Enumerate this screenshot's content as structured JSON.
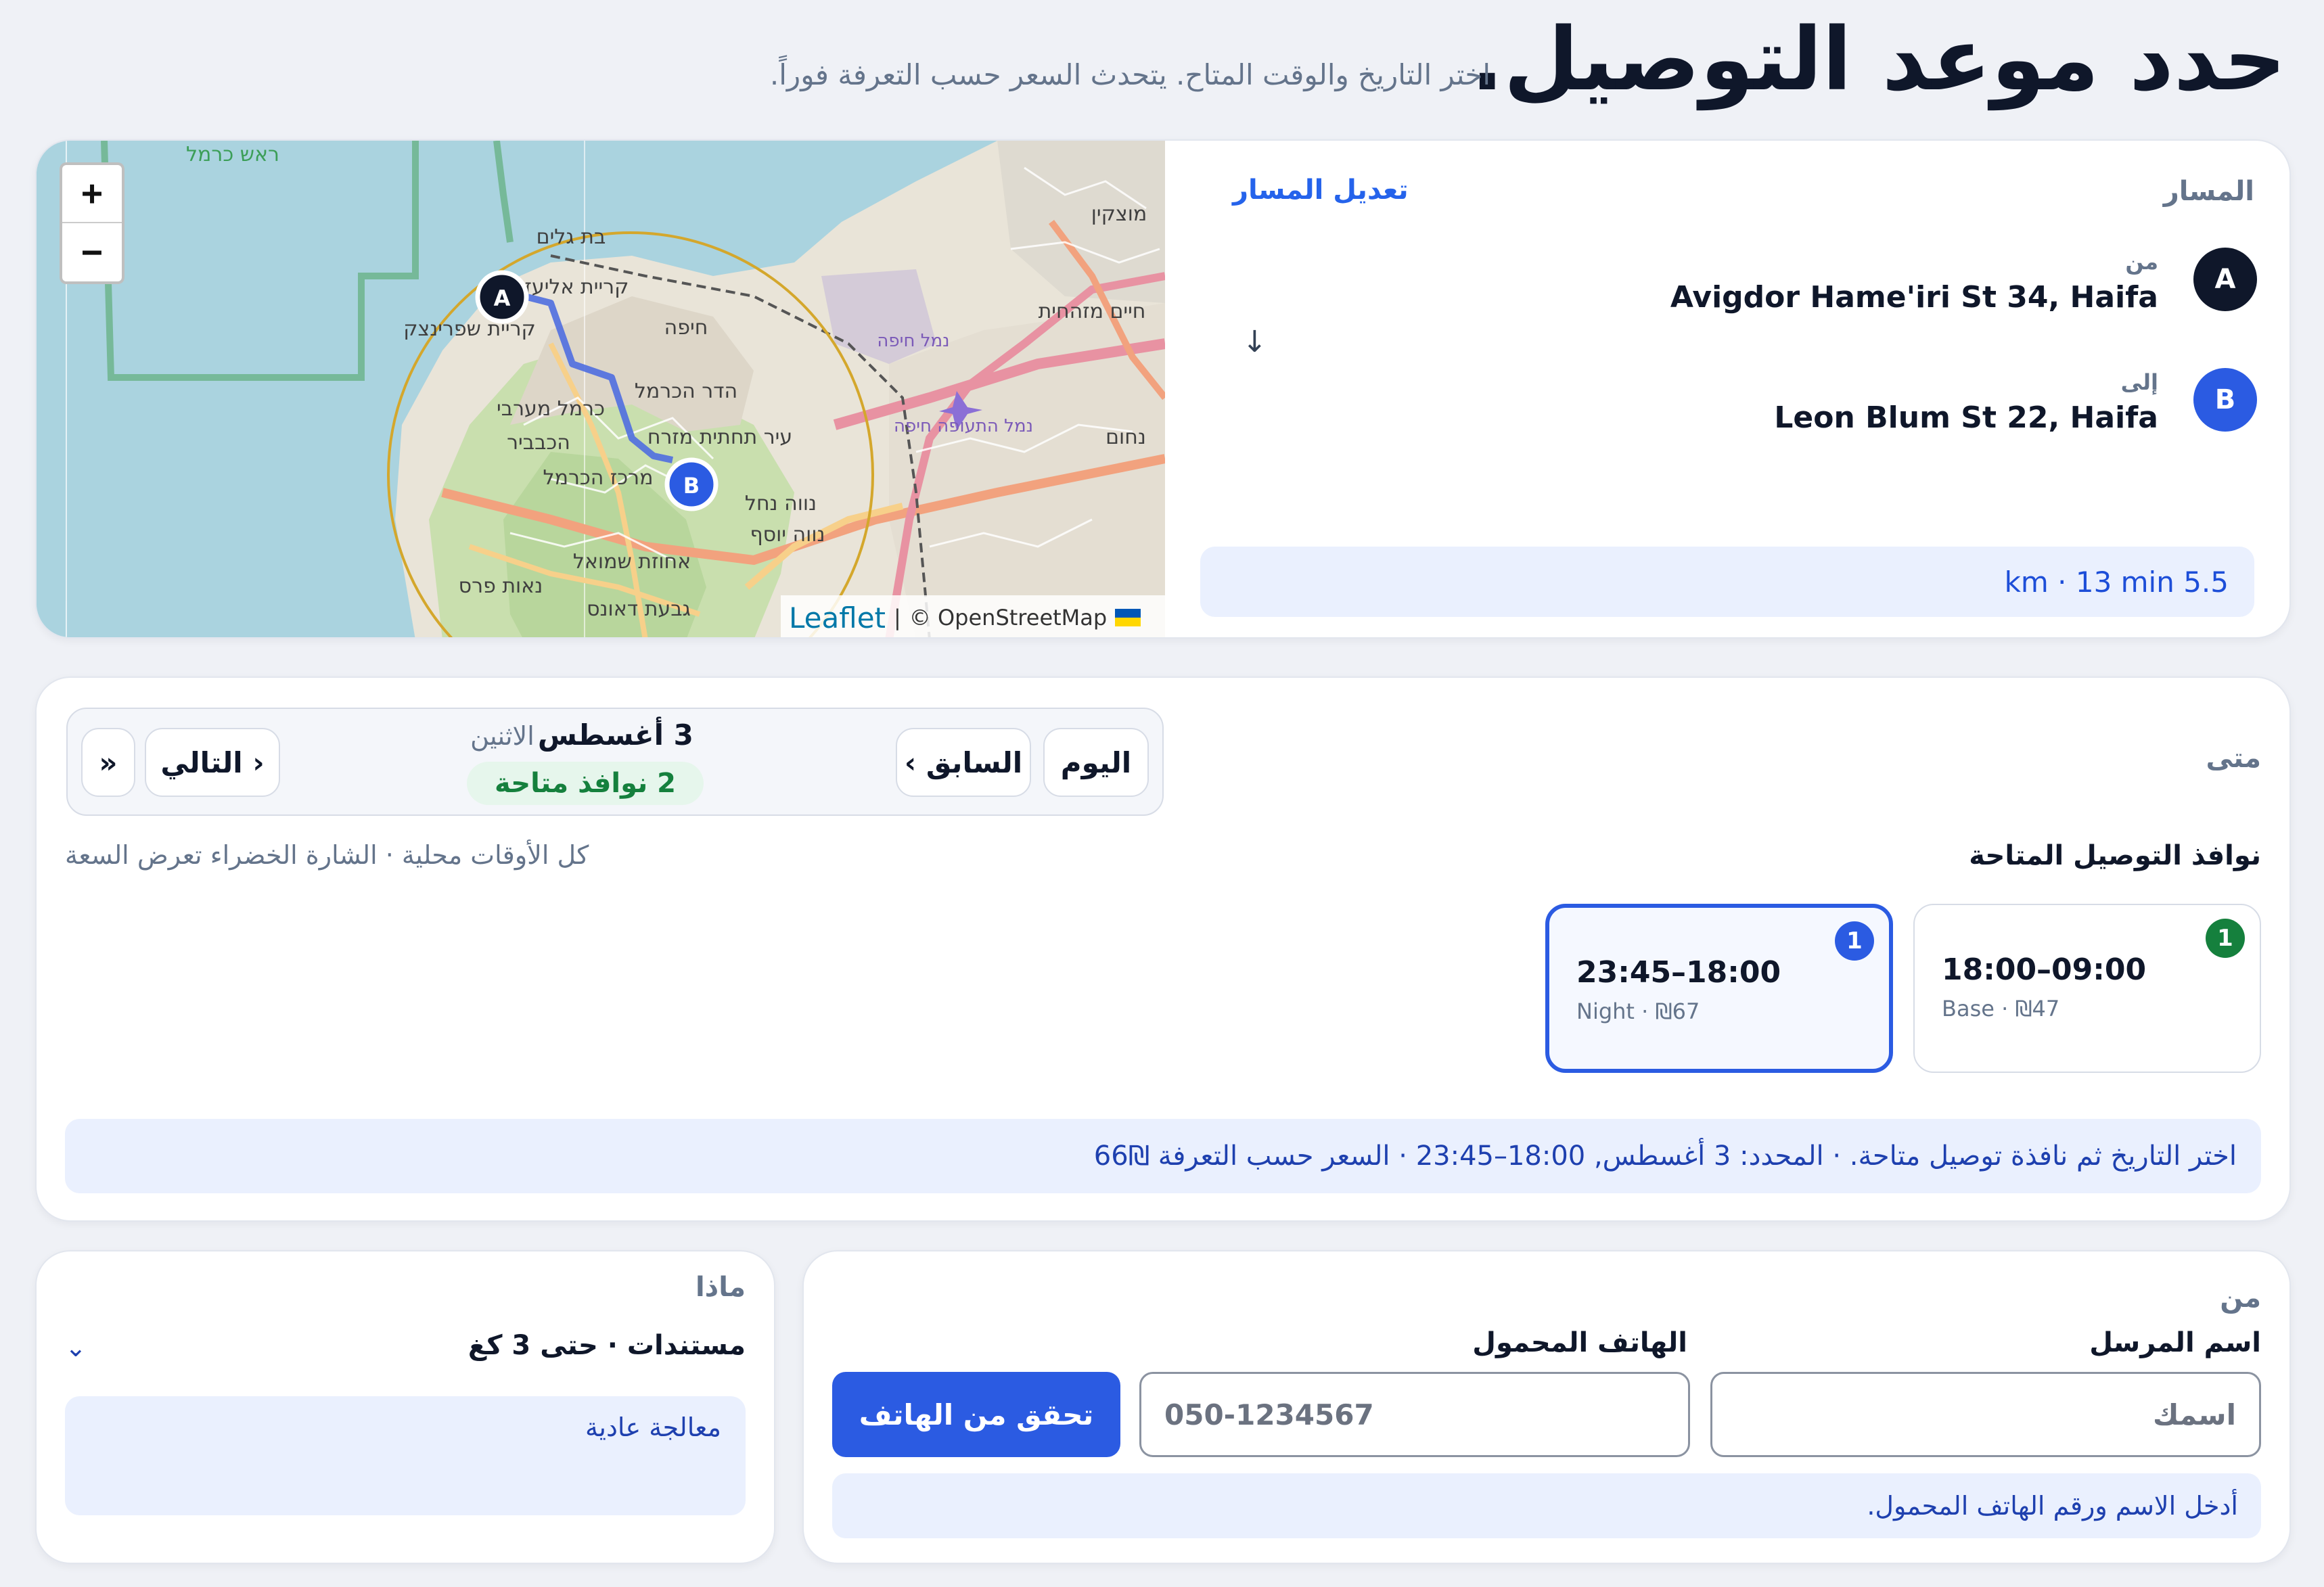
{
  "header": {
    "title": "حدد موعد التوصيل.",
    "subtitle": "اختر التاريخ والوقت المتاح. يتحدث السعر حسب التعرفة فوراً."
  },
  "map": {
    "zoom_in": "+",
    "zoom_out": "−",
    "attribution_leaflet": "Leaflet",
    "attribution_sep": "|",
    "attribution_osm": "© OpenStreetMap",
    "marker_a": "A",
    "marker_b": "B",
    "places": [
      "ראש כרמל",
      "בת גלים",
      "קריית אליעזר",
      "קריית שפרינצק",
      "חיפה",
      "הדר הכרמל",
      "כרמל מערבי",
      "הכבביר",
      "עיר תחתית מזרח",
      "מרכז הכרמל",
      "נווה נחל",
      "נווה יוסף",
      "אחוזת שמואל",
      "נאות פרס",
      "גבעת דאונס",
      "נמל חיפה",
      "נמל התעופה חיפה",
      "מוצקין",
      "חיים מזהחית",
      "נחום"
    ]
  },
  "route": {
    "label": "المسار",
    "edit_link": "تعديل المسار",
    "from": {
      "badge": "A",
      "caption": "من",
      "address": "Avigdor Hame'iri St 34, Haifa"
    },
    "to": {
      "badge": "B",
      "caption": "إلى",
      "address": "Leon Blum St 22, Haifa"
    },
    "arrow": "↓",
    "eta": "km · 13 min 5.5"
  },
  "when": {
    "label": "متى",
    "nav": {
      "today": "اليوم",
      "prev": "‹ السابق",
      "next": "التالي ›",
      "jump": "»"
    },
    "date_strong": "3 أغسطس",
    "date_weekday": "الاثنين",
    "available": "2 نوافذ متاحة",
    "slots_title": "نوافذ التوصيل المتاحة",
    "slots_hint": "كل الأوقات محلية · الشارة الخضراء تعرض السعة",
    "slots": [
      {
        "time": "18:00–09:00",
        "meta": "Base · ₪47",
        "capacity": "1",
        "badge_color": "#15803d",
        "selected": false
      },
      {
        "time": "23:45–18:00",
        "meta": "Night · ₪67",
        "capacity": "1",
        "badge_color": "#2b5be2",
        "selected": true
      }
    ],
    "summary": "اختر التاريخ ثم نافذة توصيل متاحة. · المحدد: 3 أغسطس, 18:00–23:45 · السعر حسب التعرفة ₪66"
  },
  "sender": {
    "label": "من",
    "name_label": "اسم المرسل",
    "name_placeholder": "اسمك",
    "phone_label": "الهاتف المحمول",
    "phone_placeholder": "050-1234567",
    "verify_button": "تحقق من الهاتف",
    "hint": "أدخل الاسم ورقم الهاتف المحمول."
  },
  "what": {
    "label": "ماذا",
    "selected": "مستندات · حتى 3 كغ",
    "chevron": "⌄",
    "note": "معالجة عادية"
  },
  "colors": {
    "accent": "#2b5be2",
    "success": "#15803d",
    "marker_a": "#0f172a",
    "marker_b": "#2b5be2"
  }
}
